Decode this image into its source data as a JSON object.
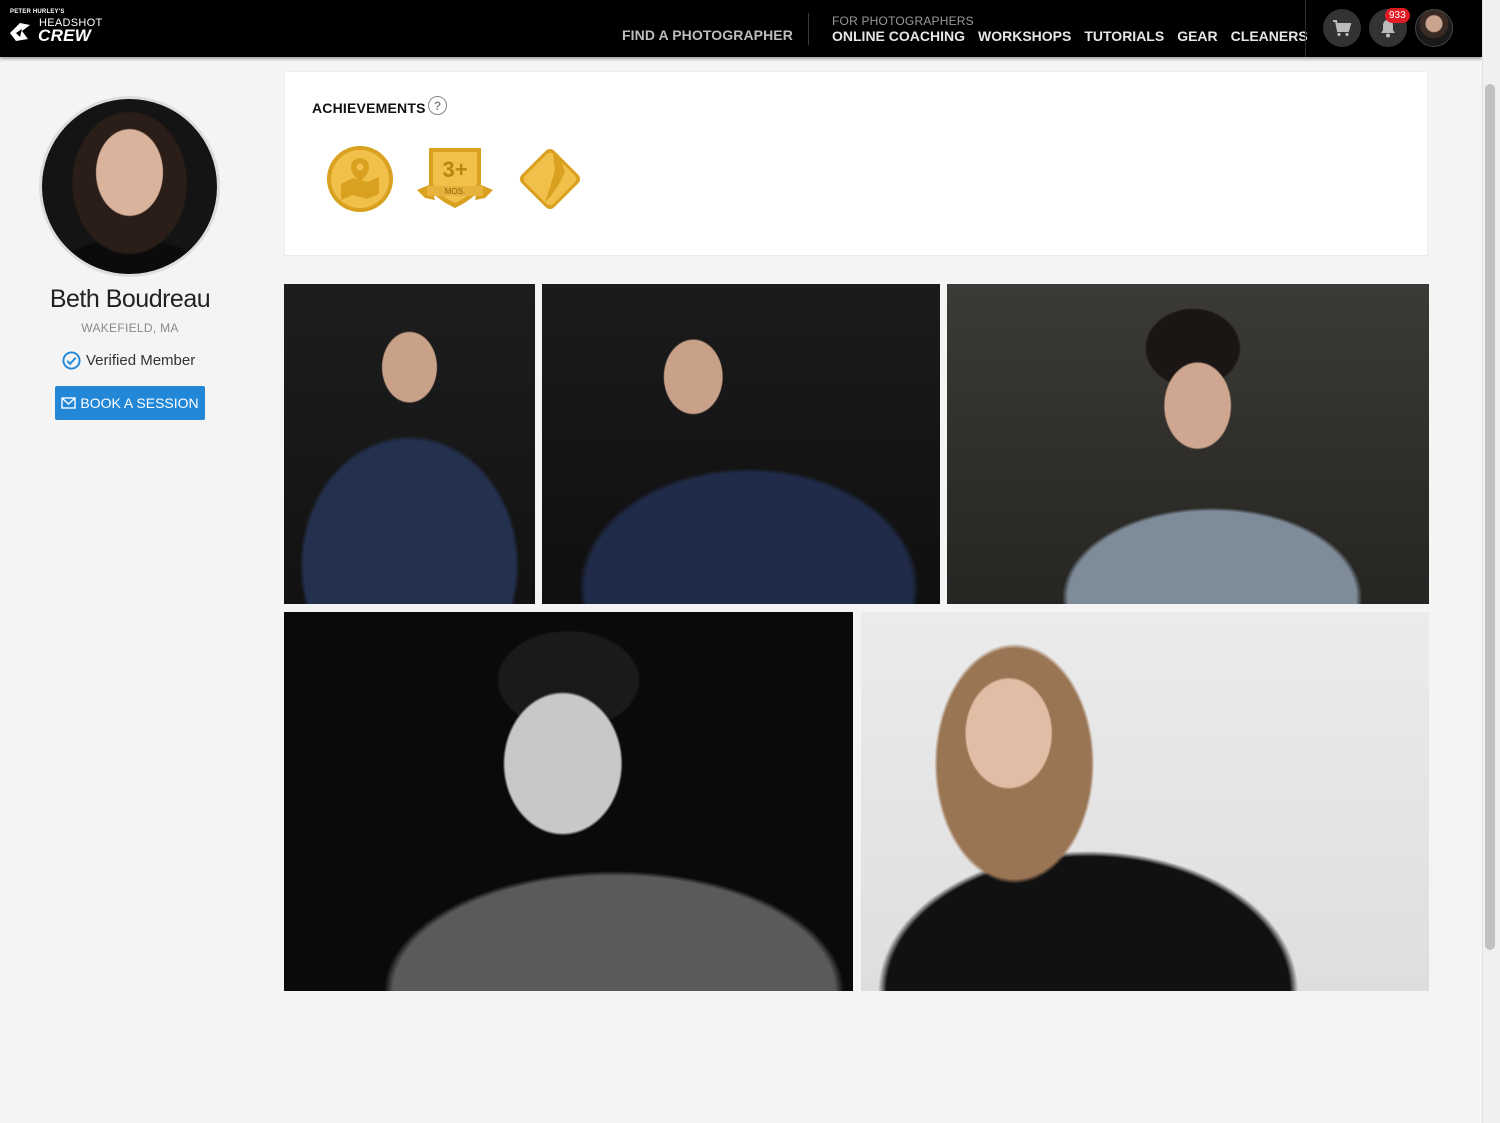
{
  "header": {
    "logo": {
      "pre": "PETER HURLEY'S",
      "line1": "HEADSHOT",
      "line2": "CREW"
    },
    "find_photographer": "FIND A PHOTOGRAPHER",
    "for_photographers": "FOR PHOTOGRAPHERS",
    "nav": [
      "ONLINE COACHING",
      "WORKSHOPS",
      "TUTORIALS",
      "GEAR",
      "CLEANERS"
    ],
    "notification_count": "933",
    "icons": [
      "cart-icon",
      "bell-icon",
      "user-avatar"
    ]
  },
  "profile": {
    "name": "Beth Boudreau",
    "location": "WAKEFIELD, MA",
    "verified_label": "Verified Member",
    "book_label": "BOOK A SESSION"
  },
  "achievements": {
    "title": "ACHIEVEMENTS",
    "help": "?",
    "badges": [
      {
        "name": "location-map-badge"
      },
      {
        "name": "three-plus-months-badge",
        "text": "3+",
        "sub": "MOS."
      },
      {
        "name": "state-badge"
      }
    ]
  },
  "gallery": {
    "photos": [
      "headshot-man-suit-1",
      "headshot-man-suit-2",
      "headshot-young-man-denim",
      "headshot-young-man-bw",
      "headshot-woman-turtleneck"
    ]
  },
  "colors": {
    "header_bg": "#000000",
    "button_blue": "#2287d6",
    "badge_red": "#e21b24",
    "gold": "#e6b23c"
  }
}
